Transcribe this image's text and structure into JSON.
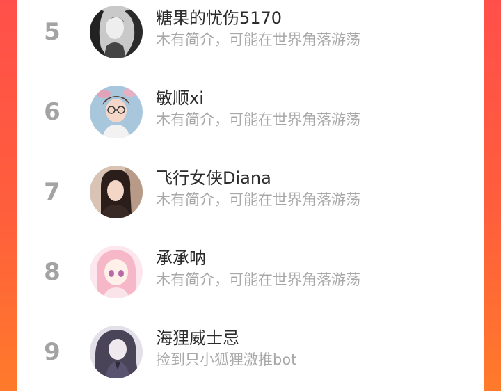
{
  "colors": {
    "side_gradient_top": "#ff4f4a",
    "side_gradient_bottom": "#ff7a2a",
    "rank_color": "#a3a3a3",
    "name_color": "#2b2b2b",
    "bio_color": "#a8a8a8"
  },
  "list": {
    "items": [
      {
        "rank": "5",
        "name": "糖果的忧伤5170",
        "bio": "木有简介，可能在世界角落游荡",
        "avatar": "user-avatar"
      },
      {
        "rank": "6",
        "name": "敏顺xi",
        "bio": "木有简介，可能在世界角落游荡",
        "avatar": "user-avatar"
      },
      {
        "rank": "7",
        "name": "飞行女侠Diana",
        "bio": "木有简介，可能在世界角落游荡",
        "avatar": "user-avatar"
      },
      {
        "rank": "8",
        "name": "承承呐",
        "bio": "木有简介，可能在世界角落游荡",
        "avatar": "user-avatar"
      },
      {
        "rank": "9",
        "name": "海狸威士忌",
        "bio": "捡到只小狐狸激推bot",
        "avatar": "user-avatar"
      }
    ]
  }
}
